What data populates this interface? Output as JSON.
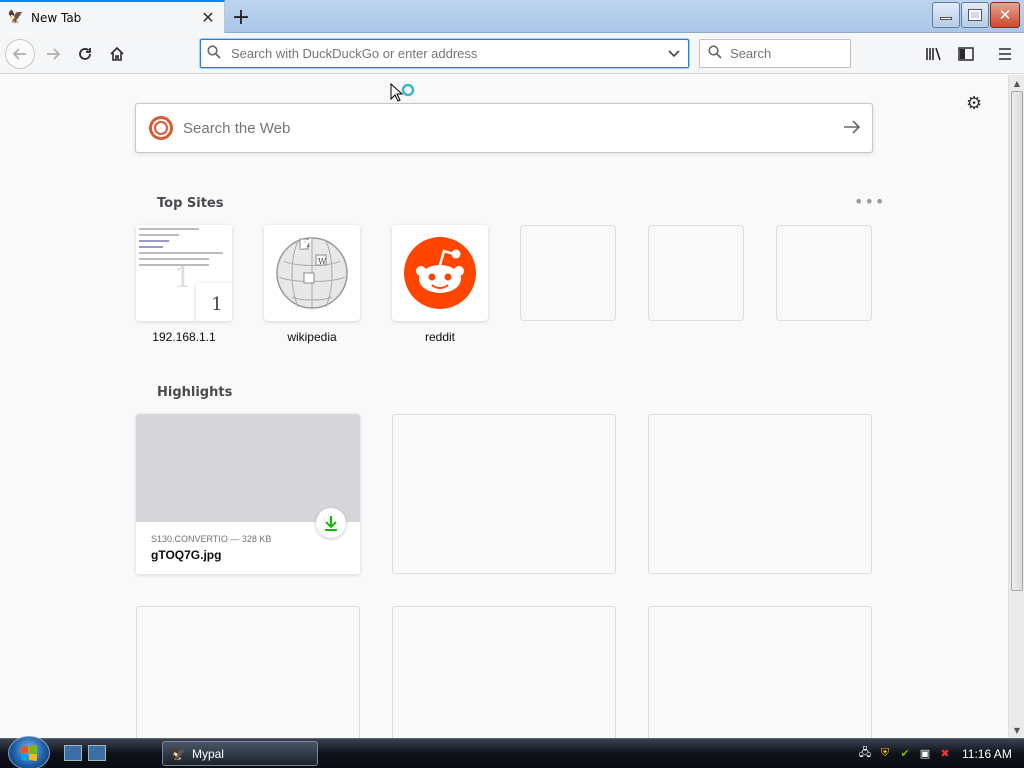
{
  "tab": {
    "title": "New Tab",
    "close_glyph": "✕",
    "newtab_glyph": "+"
  },
  "nav": {
    "address_placeholder": "Search with DuckDuckGo or enter address",
    "search_placeholder": "Search"
  },
  "newtab": {
    "web_search_placeholder": "Search the Web",
    "top_sites_title": "Top Sites",
    "top_sites": [
      {
        "label": "192.168.1.1",
        "badge": "1"
      },
      {
        "label": "wikipedia"
      },
      {
        "label": "reddit"
      },
      {
        "label": ""
      },
      {
        "label": ""
      },
      {
        "label": ""
      }
    ],
    "highlights_title": "Highlights",
    "highlights": [
      {
        "meta": "S130.CONVERTIO — 328 KB",
        "filename": "gTOQ7G.jpg"
      }
    ]
  },
  "taskbar": {
    "task_label": "Mypal",
    "clock": "11:16 AM"
  },
  "colors": {
    "accent": "#0a84ff",
    "reddit": "#ff4500",
    "download": "#12bc00",
    "ddg": "#de5833"
  }
}
